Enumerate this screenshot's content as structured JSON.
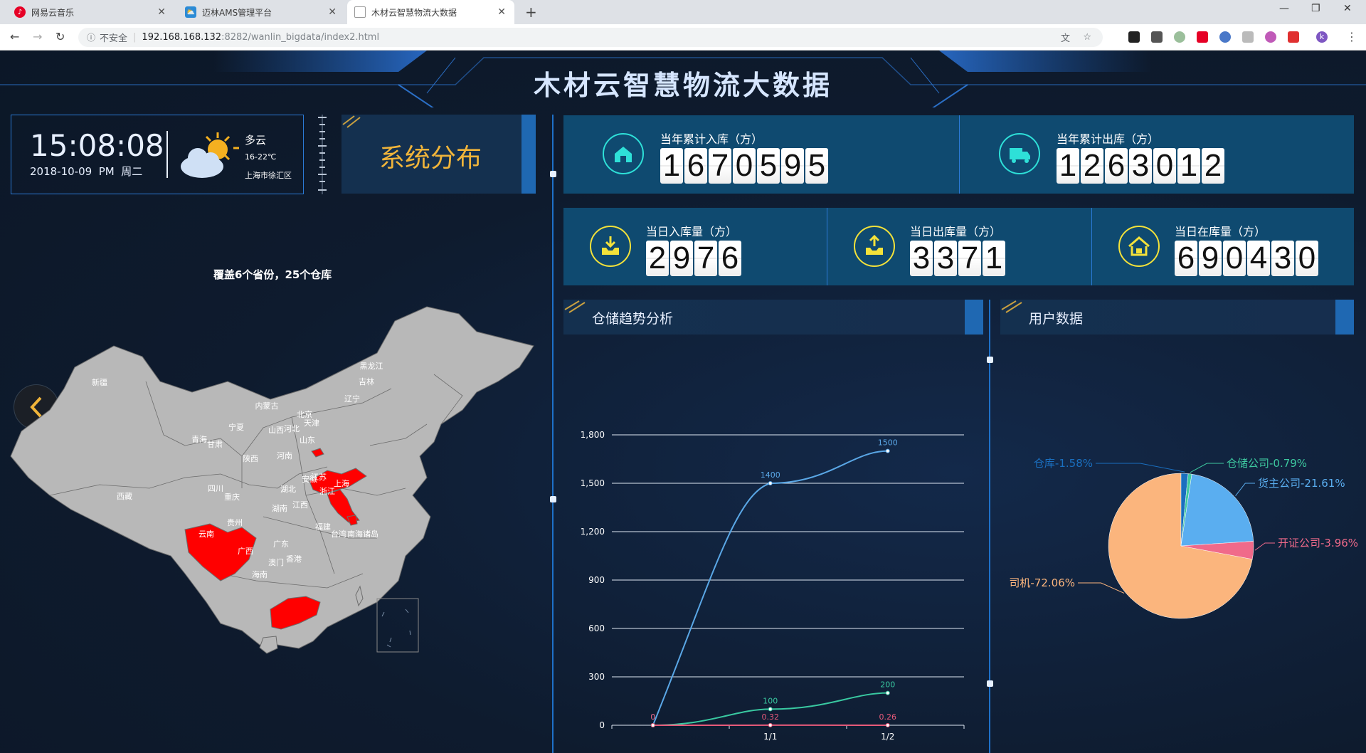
{
  "browser": {
    "tabs": [
      {
        "title": "网易云音乐",
        "active": false,
        "icon_color": "#e60026"
      },
      {
        "title": "迈林AMS管理平台",
        "active": false,
        "icon_color": "#2b8bd6"
      },
      {
        "title": "木材云智慧物流大数据",
        "active": true,
        "icon_color": "#888888"
      }
    ],
    "insecure_label": "不安全",
    "url_host": "192.168.168.132",
    "url_path": ":8282/wanlin_bigdata/index2.html",
    "profile_initial": "k"
  },
  "dashboard": {
    "title": "木材云智慧物流大数据",
    "clock": {
      "time": "15:08:08",
      "date": "2018-10-09  PM  周二"
    },
    "weather": {
      "desc": "多云",
      "temp": "16-22℃",
      "location": "上海市徐汇区"
    },
    "system_panel": "系统分布",
    "map": {
      "caption": "覆盖6个省份，25个仓库",
      "provinces": [
        "新疆",
        "西藏",
        "青海",
        "甘肃",
        "宁夏",
        "内蒙古",
        "黑龙江",
        "吉林",
        "辽宁",
        "北京",
        "天津",
        "河北",
        "山西",
        "陕西",
        "河南",
        "山东",
        "江苏",
        "上海",
        "安徽",
        "浙江",
        "湖北",
        "四川",
        "重庆",
        "湖南",
        "江西",
        "贵州",
        "云南",
        "广西",
        "广东",
        "福建",
        "台湾",
        "香港",
        "澳门",
        "海南",
        "南海诸岛"
      ],
      "highlighted": [
        "四川",
        "山东",
        "江苏",
        "上海",
        "广东",
        "北京"
      ]
    },
    "stats_top": [
      {
        "label": "当年累计入库（方）",
        "value": "1670595",
        "icon": "warehouse-icon"
      },
      {
        "label": "当年累计出库（方）",
        "value": "1263012",
        "icon": "truck-icon"
      }
    ],
    "stats_bottom": [
      {
        "label": "当日入库量（方）",
        "value": "2976",
        "icon": "inbox-in-icon"
      },
      {
        "label": "当日出库量（方）",
        "value": "3371",
        "icon": "inbox-out-icon"
      },
      {
        "label": "当日在库量（方）",
        "value": "690430",
        "icon": "home-icon"
      }
    ],
    "trend_title": "仓储趋势分析",
    "user_title": "用户数据"
  },
  "chart_data": [
    {
      "type": "line",
      "title": "仓储趋势分析",
      "categories": [
        "",
        "1/1",
        "1/2"
      ],
      "ylim": [
        0,
        1800
      ],
      "yticks": [
        "0",
        "300",
        "600",
        "900",
        "1,200",
        "1,500",
        "1,800"
      ],
      "series": [
        {
          "values": [
            0,
            1500,
            1700
          ],
          "labels": [
            "0",
            "1400",
            "1500"
          ],
          "color": "#5aa7e6"
        },
        {
          "values": [
            0,
            100,
            200
          ],
          "labels": [
            "",
            "100",
            "200"
          ],
          "color": "#39c9a1"
        },
        {
          "values": [
            0,
            0.32,
            0.26
          ],
          "labels": [
            "0",
            "0.32",
            "0.26"
          ],
          "color": "#e85a7a"
        }
      ],
      "grid": true
    },
    {
      "type": "pie",
      "title": "用户数据",
      "slices": [
        {
          "name": "司机",
          "value": 72.06,
          "label": "司机-72.06%",
          "color": "#fbb57d"
        },
        {
          "name": "仓库",
          "value": 1.58,
          "label": "仓库-1.58%",
          "color": "#1a6fbf"
        },
        {
          "name": "仓储公司",
          "value": 0.79,
          "label": "仓储公司-0.79%",
          "color": "#3ec9a0"
        },
        {
          "name": "货主公司",
          "value": 21.61,
          "label": "货主公司-21.61%",
          "color": "#5aaef0"
        },
        {
          "name": "开证公司",
          "value": 3.96,
          "label": "开证公司-3.96%",
          "color": "#f06a8a"
        }
      ]
    }
  ]
}
